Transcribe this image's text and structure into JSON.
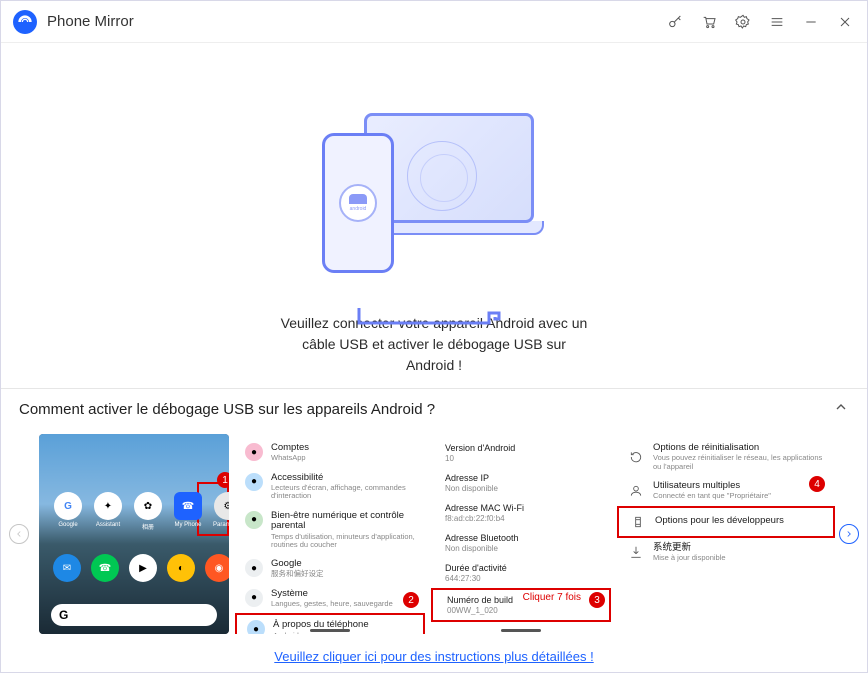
{
  "titlebar": {
    "title": "Phone Mirror"
  },
  "main": {
    "illus_android": "android",
    "message_l1": "Veuillez connecter votre appareil Android avec un",
    "message_l2": "câble USB et activer le débogage USB sur",
    "message_l3": "Android !"
  },
  "howto": {
    "title": "Comment activer le débogage USB sur les appareils Android ?"
  },
  "p1": {
    "badge": "1",
    "icons": {
      "google": "Google",
      "assistant": "Assistant",
      "photos": "相册",
      "myphone": "My Phone",
      "parametres": "Paramètres"
    },
    "search_g": "G"
  },
  "p2": {
    "badge": "2",
    "items": [
      {
        "title": "Comptes",
        "sub": "WhatsApp",
        "color": "pink"
      },
      {
        "title": "Accessibilité",
        "sub": "Lecteurs d'écran, affichage, commandes d'interaction",
        "color": "blue"
      },
      {
        "title": "Bien-être numérique et contrôle parental",
        "sub": "Temps d'utilisation, minuteurs d'application, routines du coucher",
        "color": "green"
      },
      {
        "title": "Google",
        "sub": "服务和偏好设定",
        "color": "gray"
      },
      {
        "title": "Système",
        "sub": "Langues, gestes, heure, sauvegarde",
        "color": "gray"
      },
      {
        "title": "À propos du téléphone",
        "sub": "Android",
        "color": "blue",
        "boxed": true
      }
    ]
  },
  "p3": {
    "badge": "3",
    "anno": "Cliquer 7 fois",
    "items": [
      {
        "k": "Version d'Android",
        "v": "10"
      },
      {
        "k": "Adresse IP",
        "v": "Non disponible"
      },
      {
        "k": "Adresse MAC Wi-Fi",
        "v": "f8:ad:cb:22:f0:b4"
      },
      {
        "k": "Adresse Bluetooth",
        "v": "Non disponible"
      },
      {
        "k": "Durée d'activité",
        "v": "644:27:30"
      },
      {
        "k": "Numéro de build",
        "v": "00WW_1_020",
        "boxed": true
      }
    ]
  },
  "p4": {
    "badge": "4",
    "items": [
      {
        "title": "Options de réinitialisation",
        "sub": "Vous pouvez réinitialiser le réseau, les applications ou l'appareil",
        "icon": "reset"
      },
      {
        "title": "Utilisateurs multiples",
        "sub": "Connecté en tant que \"Propriétaire\"",
        "icon": "user"
      },
      {
        "title": "Options pour les développeurs",
        "sub": "",
        "icon": "devops",
        "boxed": true
      },
      {
        "title": "系统更新",
        "sub": "Mise à jour disponible",
        "icon": "update"
      }
    ]
  },
  "footer": {
    "link": "Veuillez cliquer ici pour des instructions plus détaillées !"
  }
}
